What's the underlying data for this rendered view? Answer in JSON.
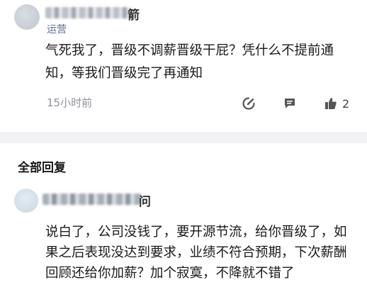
{
  "post": {
    "author_visible_suffix": "箭",
    "role": "运营",
    "text": "气死我了，晋级不调薪晋级干屁？凭什么不提前通知，等我们晋级完了再通知",
    "time": "15小时前",
    "like_count": "2"
  },
  "replies": {
    "title": "全部回复",
    "items": [
      {
        "author_visible_suffix": "问",
        "text": "说白了，公司没钱了，要开源节流，给你晋级了，如果之后表现没达到要求，业绩不符合预期，下次薪酬回顾还给你加薪？加个寂寞，不降就不错了"
      }
    ]
  },
  "icons": {
    "edit": "edit-icon",
    "message": "message-icon",
    "like": "thumbs-up-icon"
  },
  "colors": {
    "role": "#5c6f8a",
    "time": "#8d9199",
    "separator": "#f2f2f4"
  }
}
